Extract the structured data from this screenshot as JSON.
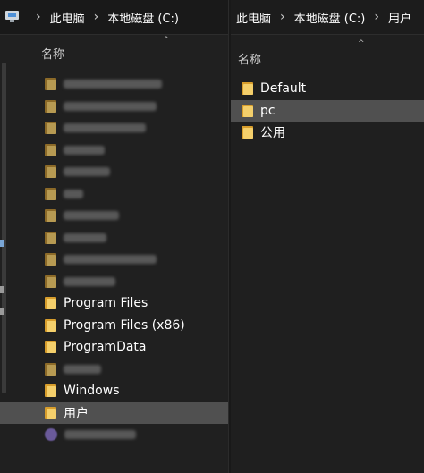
{
  "left_pane": {
    "breadcrumb": [
      "此电脑",
      "本地磁盘 (C:)"
    ],
    "column_header": "名称",
    "items": [
      {
        "label": "",
        "icon": "folder-icon",
        "blurred": true,
        "blur_width": 110
      },
      {
        "label": "",
        "icon": "folder-icon",
        "blurred": true,
        "blur_width": 104
      },
      {
        "label": "",
        "icon": "folder-icon",
        "blurred": true,
        "blur_width": 92
      },
      {
        "label": "",
        "icon": "folder-icon",
        "blurred": true,
        "blur_width": 46
      },
      {
        "label": "",
        "icon": "folder-icon",
        "blurred": true,
        "blur_width": 52
      },
      {
        "label": "",
        "icon": "folder-icon",
        "blurred": true,
        "blur_width": 22
      },
      {
        "label": "",
        "icon": "folder-icon",
        "blurred": true,
        "blur_width": 62
      },
      {
        "label": "",
        "icon": "folder-icon",
        "blurred": true,
        "blur_width": 48
      },
      {
        "label": "",
        "icon": "folder-icon",
        "blurred": true,
        "blur_width": 104
      },
      {
        "label": "",
        "icon": "folder-icon",
        "blurred": true,
        "blur_width": 58
      },
      {
        "label": "Program Files",
        "icon": "folder-icon",
        "blurred": false
      },
      {
        "label": "Program Files (x86)",
        "icon": "folder-icon",
        "blurred": false
      },
      {
        "label": "ProgramData",
        "icon": "folder-icon",
        "blurred": false
      },
      {
        "label": "",
        "icon": "folder-icon",
        "blurred": true,
        "blur_width": 42
      },
      {
        "label": "Windows",
        "icon": "folder-icon",
        "blurred": false
      },
      {
        "label": "用户",
        "icon": "folder-icon",
        "blurred": false,
        "selected": true
      },
      {
        "label": "",
        "icon": "avatar-icon",
        "blurred": true,
        "blur_width": 80
      }
    ]
  },
  "right_pane": {
    "breadcrumb": [
      "此电脑",
      "本地磁盘 (C:)",
      "用户"
    ],
    "column_header": "名称",
    "items": [
      {
        "label": "Default",
        "icon": "folder-icon"
      },
      {
        "label": "pc",
        "icon": "folder-icon",
        "selected": true
      },
      {
        "label": "公用",
        "icon": "folder-icon"
      }
    ]
  },
  "colors": {
    "background": "#191919",
    "selection": "#505050",
    "folder": "#f4cf6b"
  }
}
